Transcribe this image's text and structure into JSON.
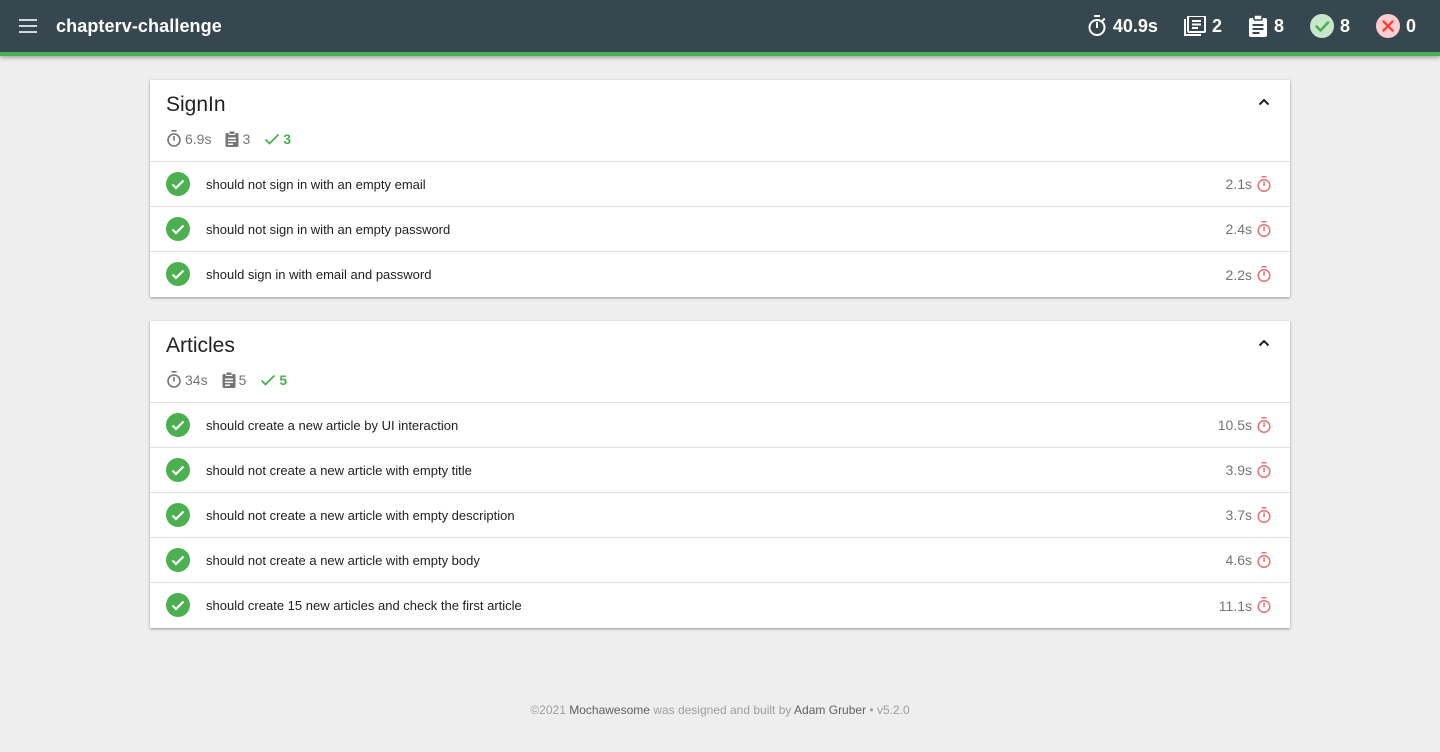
{
  "header": {
    "title": "chapterv-challenge",
    "stats": {
      "duration": "40.9s",
      "suites": "2",
      "tests": "8",
      "passes": "8",
      "failures": "0"
    }
  },
  "suites": [
    {
      "title": "SignIn",
      "duration": "6.9s",
      "tests": "3",
      "passes": "3",
      "items": [
        {
          "title": "should not sign in with an empty email",
          "duration": "2.1s"
        },
        {
          "title": "should not sign in with an empty password",
          "duration": "2.4s"
        },
        {
          "title": "should sign in with email and password",
          "duration": "2.2s"
        }
      ]
    },
    {
      "title": "Articles",
      "duration": "34s",
      "tests": "5",
      "passes": "5",
      "items": [
        {
          "title": "should create a new article by UI interaction",
          "duration": "10.5s"
        },
        {
          "title": "should not create a new article with empty title",
          "duration": "3.9s"
        },
        {
          "title": "should not create a new article with empty description",
          "duration": "3.7s"
        },
        {
          "title": "should not create a new article with empty body",
          "duration": "4.6s"
        },
        {
          "title": "should create 15 new articles and check the first article",
          "duration": "11.1s"
        }
      ]
    }
  ],
  "footer": {
    "copyright": "©2021",
    "brand": "Mochawesome",
    "middle": "was designed and built by",
    "author": "Adam Gruber",
    "version": "• v5.2.0"
  },
  "colors": {
    "topbar": "#37474f",
    "accent": "#4caf50",
    "fail": "#f44336"
  }
}
